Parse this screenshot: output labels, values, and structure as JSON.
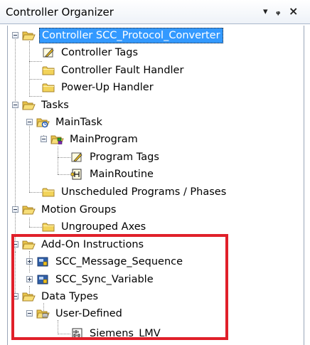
{
  "panel": {
    "title": "Controller Organizer",
    "dropdown_glyph": "▾",
    "pin_glyph": "ᵩ",
    "close_glyph": "×"
  },
  "tree": {
    "controller": "Controller SCC_Protocol_Converter",
    "controller_tags": "Controller Tags",
    "fault_handler": "Controller Fault Handler",
    "powerup_handler": "Power-Up Handler",
    "tasks": "Tasks",
    "main_task": "MainTask",
    "main_program": "MainProgram",
    "program_tags": "Program Tags",
    "main_routine": "MainRoutine",
    "unscheduled": "Unscheduled Programs / Phases",
    "motion_groups": "Motion Groups",
    "ungrouped_axes": "Ungrouped Axes",
    "add_on": "Add-On Instructions",
    "aoi_message": "SCC_Message_Sequence",
    "aoi_sync": "SCC_Sync_Variable",
    "data_types": "Data Types",
    "user_defined": "User-Defined",
    "siemens": "Siemens_LMV"
  },
  "colors": {
    "selection": "#3399ff",
    "highlight_box": "#e0202a",
    "folder": "#f2d35a"
  }
}
